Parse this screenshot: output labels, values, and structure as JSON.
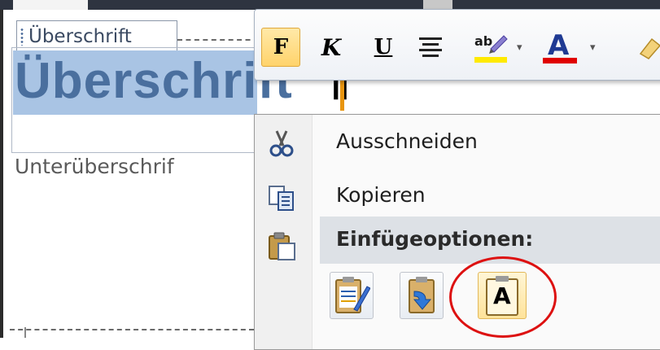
{
  "content_control": {
    "tag_label": "Überschrift",
    "heading_text": "Überschrift",
    "pilcrow": "¶",
    "subheading_text": "Unterüberschrif"
  },
  "mini_toolbar": {
    "bold_label": "F",
    "italic_label": "K",
    "underline_label": "U",
    "font_color_label": "A",
    "highlight_color": "#ffea00",
    "font_color": "#e00000"
  },
  "context_menu": {
    "cut_label": "Ausschneiden",
    "copy_label": "Kopieren",
    "paste_options_label": "Einfügeoptionen:",
    "paste_options": [
      {
        "name": "keep-source-formatting",
        "icon": "clipboard-brush-icon"
      },
      {
        "name": "merge-formatting",
        "icon": "clipboard-arrow-icon"
      },
      {
        "name": "keep-text-only",
        "icon": "clipboard-text-icon",
        "label": "A"
      }
    ]
  },
  "colors": {
    "selection": "#a9c4e4",
    "heading": "#4a6f9e",
    "annotation_circle": "#dd1111"
  }
}
